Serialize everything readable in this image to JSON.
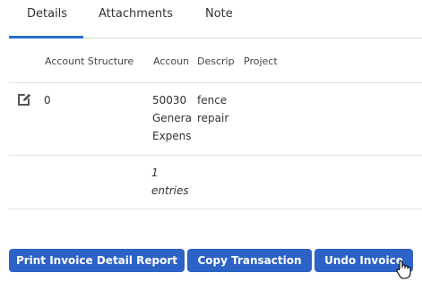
{
  "tabs": [
    {
      "label": "Details",
      "active": true
    },
    {
      "label": "Attachments",
      "active": false
    },
    {
      "label": "Note",
      "active": false
    }
  ],
  "table": {
    "headers": [
      "Account Structure",
      "Accoun",
      "Descrip",
      "Project"
    ],
    "rows": [
      {
        "edit_icon": "edit-icon",
        "account_structure": "0",
        "account": "50030\nGenera\nExpens",
        "description": "fence\nrepair",
        "project": ""
      }
    ],
    "footer": {
      "entries": "1\nentries"
    }
  },
  "buttons": {
    "print": "Print Invoice Detail Report",
    "copy": "Copy Transaction",
    "undo": "Undo Invoice"
  },
  "colors": {
    "accent": "#2a6fcb",
    "button": "#2d62c6"
  }
}
